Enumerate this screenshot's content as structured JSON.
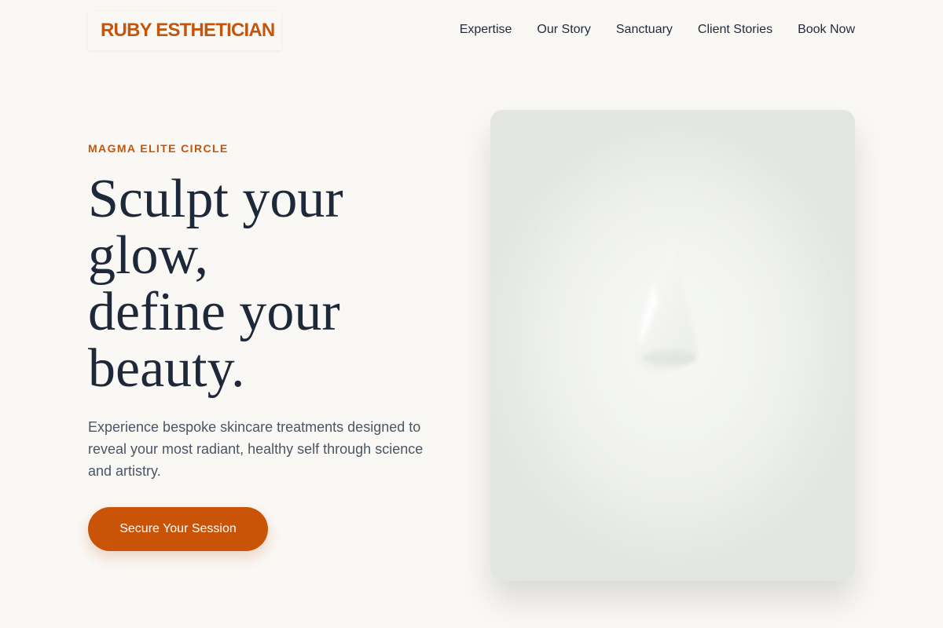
{
  "brand": {
    "name": "RUBY ESTHETICIAN",
    "accent_color": "#c4560a",
    "cta_color": "#c95306"
  },
  "nav": {
    "items": [
      {
        "label": "Expertise"
      },
      {
        "label": "Our Story"
      },
      {
        "label": "Sanctuary"
      },
      {
        "label": "Client Stories"
      },
      {
        "label": "Book Now"
      }
    ]
  },
  "hero": {
    "eyebrow": "MAGMA ELITE CIRCLE",
    "headline_lines": [
      "Sculpt your",
      "glow,",
      "define your",
      "beauty."
    ],
    "description": "Experience bespoke skincare treatments designed to reveal your most radiant, healthy self through science and artistry.",
    "cta_label": "Secure Your Session"
  }
}
